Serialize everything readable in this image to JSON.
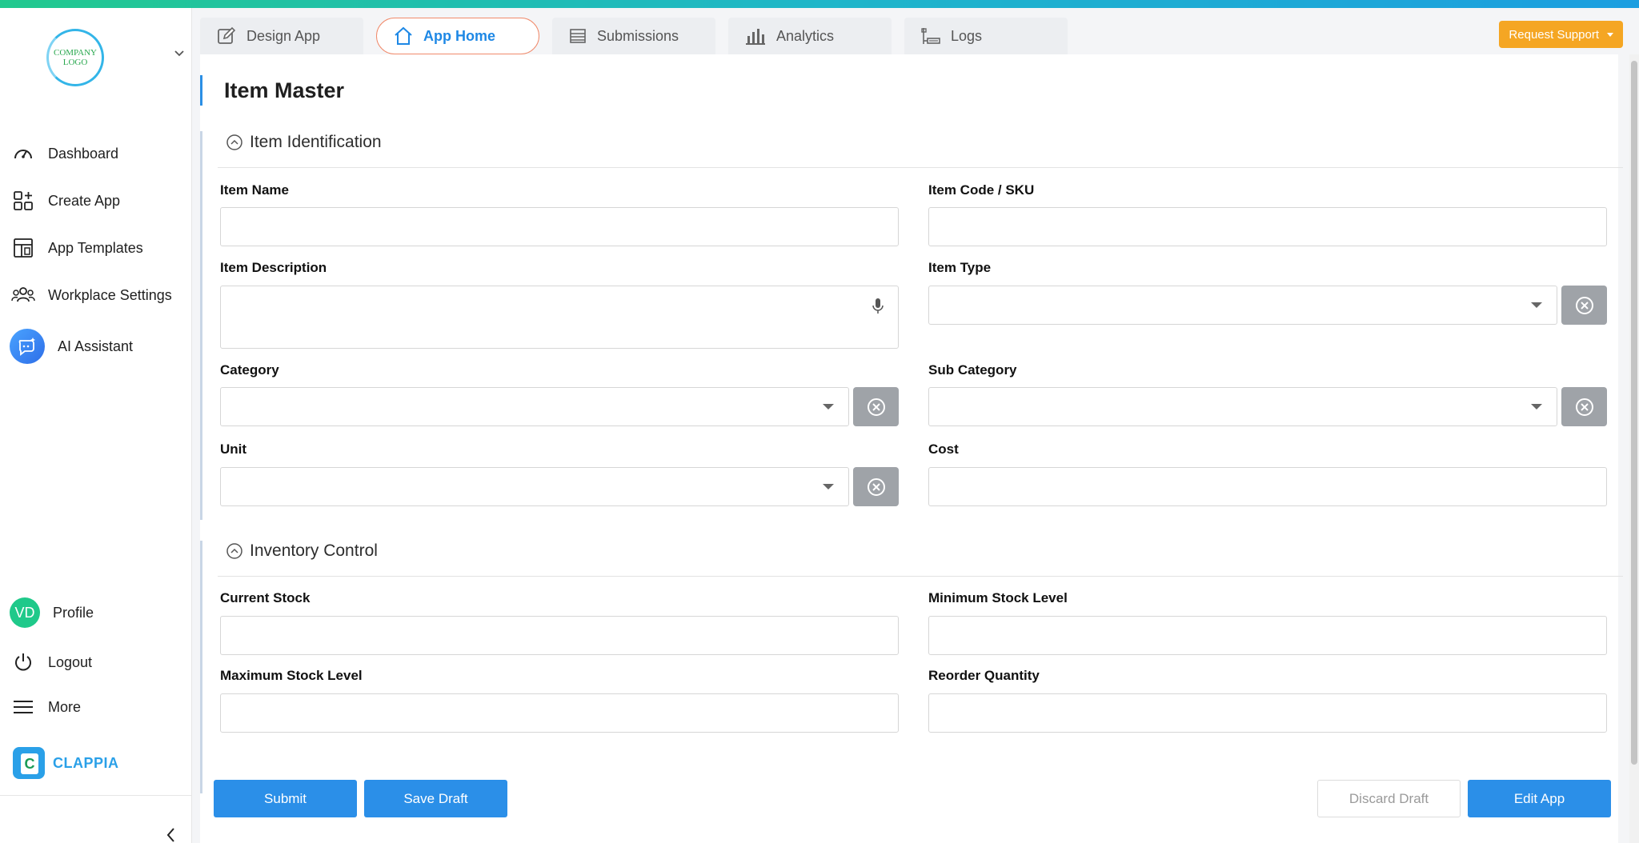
{
  "sidebar": {
    "logo_text": [
      "COMPANY",
      "LOGO"
    ],
    "items": [
      {
        "label": "Dashboard",
        "icon": "dashboard-gauge-icon"
      },
      {
        "label": "Create App",
        "icon": "create-app-icon"
      },
      {
        "label": "App Templates",
        "icon": "templates-icon"
      },
      {
        "label": "Workplace Settings",
        "icon": "people-icon"
      },
      {
        "label": "AI Assistant",
        "icon": "ai-assistant-icon"
      }
    ],
    "profile": {
      "initials": "VD",
      "label": "Profile"
    },
    "logout_label": "Logout",
    "more_label": "More",
    "brand": "CLAPPIA",
    "accent": "#2aa0e8"
  },
  "tabs": [
    {
      "label": "Design App",
      "icon": "edit-icon"
    },
    {
      "label": "App Home",
      "icon": "home-icon",
      "active": true
    },
    {
      "label": "Submissions",
      "icon": "list-icon"
    },
    {
      "label": "Analytics",
      "icon": "bar-chart-icon"
    },
    {
      "label": "Logs",
      "icon": "logs-icon"
    }
  ],
  "request_support": "Request Support",
  "page_title": "Item Master",
  "sections": [
    {
      "title": "Item Identification",
      "fields": {
        "item_name": {
          "label": "Item Name",
          "value": ""
        },
        "item_code": {
          "label": "Item Code / SKU",
          "value": ""
        },
        "item_description": {
          "label": "Item Description",
          "value": ""
        },
        "item_type": {
          "label": "Item Type",
          "value": ""
        },
        "category": {
          "label": "Category",
          "value": ""
        },
        "sub_category": {
          "label": "Sub Category",
          "value": ""
        },
        "unit": {
          "label": "Unit",
          "value": ""
        },
        "cost": {
          "label": "Cost",
          "value": ""
        }
      }
    },
    {
      "title": "Inventory Control",
      "fields": {
        "current_stock": {
          "label": "Current Stock",
          "value": ""
        },
        "min_stock": {
          "label": "Minimum Stock Level",
          "value": ""
        },
        "max_stock": {
          "label": "Maximum Stock Level",
          "value": ""
        },
        "reorder_qty": {
          "label": "Reorder Quantity",
          "value": ""
        }
      }
    }
  ],
  "actions": {
    "submit": "Submit",
    "save_draft": "Save Draft",
    "discard_draft": "Discard Draft",
    "edit_app": "Edit App"
  },
  "colors": {
    "primary": "#2b8fe8",
    "support": "#f5a623",
    "active_tab_border": "#f08a6b"
  }
}
